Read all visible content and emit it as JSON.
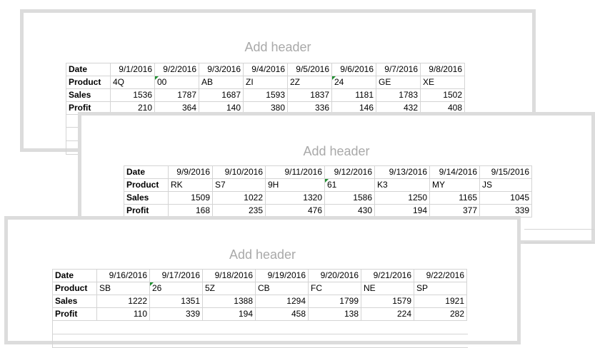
{
  "pages": [
    {
      "header": "Add header",
      "table": {
        "labels": [
          "Date",
          "Product",
          "Sales",
          "Profit"
        ],
        "dates": [
          "9/1/2016",
          "9/2/2016",
          "9/3/2016",
          "9/4/2016",
          "9/5/2016",
          "9/6/2016",
          "9/7/2016",
          "9/8/2016"
        ],
        "products": [
          "4Q",
          "00",
          "AB",
          "ZI",
          "2Z",
          "24",
          "GE",
          "XE"
        ],
        "sales": [
          1536,
          1787,
          1687,
          1593,
          1837,
          1181,
          1783,
          1502
        ],
        "profit": [
          210,
          364,
          140,
          380,
          336,
          146,
          432,
          408
        ]
      }
    },
    {
      "header": "Add header",
      "table": {
        "labels": [
          "Date",
          "Product",
          "Sales",
          "Profit"
        ],
        "dates": [
          "9/9/2016",
          "9/10/2016",
          "9/11/2016",
          "9/12/2016",
          "9/13/2016",
          "9/14/2016",
          "9/15/2016"
        ],
        "products": [
          "RK",
          "S7",
          "9H",
          "61",
          "K3",
          "MY",
          "JS"
        ],
        "sales": [
          1509,
          1022,
          1320,
          1586,
          1250,
          1165,
          1045
        ],
        "profit": [
          168,
          235,
          476,
          430,
          194,
          377,
          339
        ]
      }
    },
    {
      "header": "Add header",
      "table": {
        "labels": [
          "Date",
          "Product",
          "Sales",
          "Profit"
        ],
        "dates": [
          "9/16/2016",
          "9/17/2016",
          "9/18/2016",
          "9/19/2016",
          "9/20/2016",
          "9/21/2016",
          "9/22/2016"
        ],
        "products": [
          "SB",
          "26",
          "5Z",
          "CB",
          "FC",
          "NE",
          "SP"
        ],
        "sales": [
          1222,
          1351,
          1388,
          1294,
          1799,
          1579,
          1921
        ],
        "profit": [
          110,
          339,
          194,
          458,
          138,
          224,
          282
        ]
      }
    }
  ]
}
